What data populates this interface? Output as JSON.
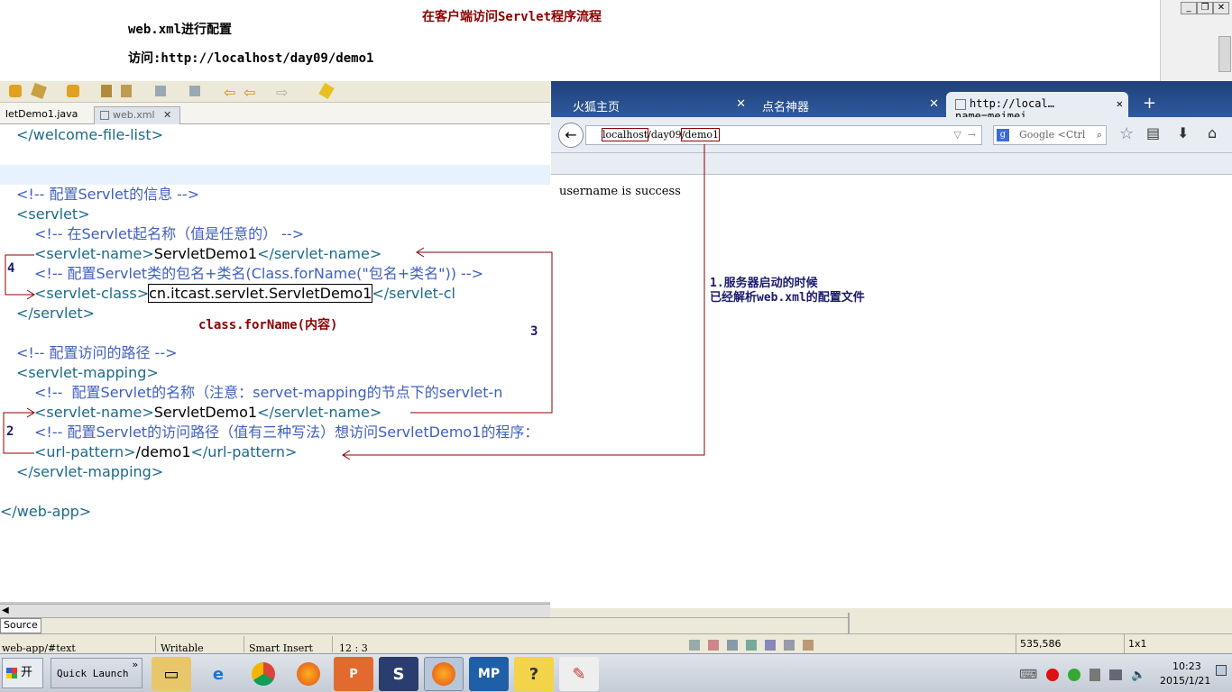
{
  "annotations": {
    "heading": "在客户端访问Servlet程序流程",
    "config_note": "web.xml进行配置",
    "access_note": "访问:http://localhost/day09/demo1",
    "classforname": "class.forName(内容)",
    "step1_line1": "1.服务器启动的时候",
    "step1_line2": "已经解析web.xml的配置文件",
    "num2": "2",
    "num3": "3",
    "num4": "4"
  },
  "eclipse": {
    "tabs": [
      {
        "label": "letDemo1.java"
      },
      {
        "label": "web.xml"
      }
    ],
    "close_glyph": "✕",
    "code": {
      "l1": "</welcome-file-list>",
      "l2": "<!-- 配置Servlet的信息 -->",
      "l3": "<servlet>",
      "l4": "<!-- 在Servlet起名称（值是任意的） -->",
      "l5a": "<servlet-name>",
      "l5b": "ServletDemo1",
      "l5c": "</servlet-name>",
      "l6": "<!-- 配置Servlet类的包名+类名(Class.forName(\"包名+类名\")) -->",
      "l7a": "<servlet-class>",
      "l7b": "cn.itcast.servlet.ServletDemo1",
      "l7c": "</servlet-cl",
      "l8": "</servlet>",
      "l9": "<!-- 配置访问的路径 -->",
      "l10": "<servlet-mapping>",
      "l11": "<!--  配置Servlet的名称（注意：servet-mapping的节点下的servlet-n",
      "l12a": "<servlet-name>",
      "l12b": "ServletDemo1",
      "l12c": "</servlet-name>",
      "l13": "<!-- 配置Servlet的访问路径（值有三种写法）想访问ServletDemo1的程序：",
      "l14a": "<url-pattern>",
      "l14b": "/demo1",
      "l14c": "</url-pattern>",
      "l15": "</servlet-mapping>",
      "l16": "</web-app>"
    },
    "source_tab": "Source",
    "status": {
      "path": "web-app/#text",
      "mode": "Writable",
      "insert": "Smart Insert",
      "pos": "12 : 3"
    }
  },
  "firefox": {
    "tabs": [
      {
        "label": "火狐主页"
      },
      {
        "label": "点名神器"
      },
      {
        "label": "http://local…name=meimei"
      }
    ],
    "tab_close": "✕",
    "new_tab": "+",
    "url_host": "localhost",
    "url_mid": "/day09",
    "url_path": "/demo1",
    "search_placeholder": "Google <Ctrl",
    "page_text": "username is success"
  },
  "statusbar_right": {
    "coords": "535,586",
    "size": "1x1"
  },
  "taskbar": {
    "start": "开始",
    "quick_launch": "Quick Launch",
    "chevron": "»",
    "clock_time": "10:23",
    "clock_date": "2015/1/21"
  },
  "colors": {
    "annotation_red": "#8b0000",
    "annotation_navy": "#1a1a6e",
    "tab_blue": "#2e5a9e"
  }
}
